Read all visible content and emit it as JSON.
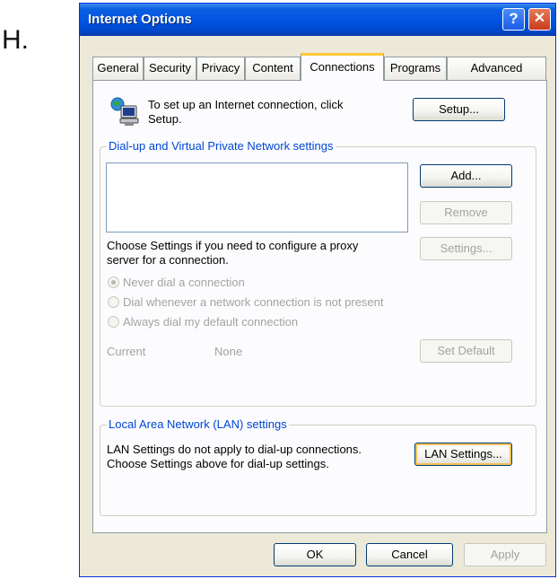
{
  "step_label": "H.",
  "window": {
    "title": "Internet Options",
    "help_glyph": "?",
    "close_glyph": "✕"
  },
  "tabs": [
    {
      "label": "General"
    },
    {
      "label": "Security"
    },
    {
      "label": "Privacy"
    },
    {
      "label": "Content"
    },
    {
      "label": "Connections",
      "active": true
    },
    {
      "label": "Programs"
    },
    {
      "label": "Advanced"
    }
  ],
  "setup": {
    "icon": "network-connection-icon",
    "text_line1": "To set up an Internet connection, click",
    "text_line2": "Setup.",
    "button": "Setup..."
  },
  "dialup": {
    "group_title": "Dial-up and Virtual Private Network settings",
    "add_button": "Add...",
    "remove_button": "Remove",
    "proxy_text_line1": "Choose Settings if you need to configure a proxy",
    "proxy_text_line2": "server for a connection.",
    "settings_button": "Settings...",
    "options": [
      {
        "label": "Never dial a connection",
        "selected": true
      },
      {
        "label": "Dial whenever a network connection is not present",
        "selected": false
      },
      {
        "label": "Always dial my default connection",
        "selected": false
      }
    ],
    "current_label": "Current",
    "current_value": "None",
    "set_default_button": "Set Default"
  },
  "lan": {
    "group_title": "Local Area Network (LAN) settings",
    "text_line1": "LAN Settings do not apply to dial-up connections.",
    "text_line2": "Choose Settings above for dial-up settings.",
    "button": "LAN Settings..."
  },
  "footer": {
    "ok": "OK",
    "cancel": "Cancel",
    "apply": "Apply"
  }
}
